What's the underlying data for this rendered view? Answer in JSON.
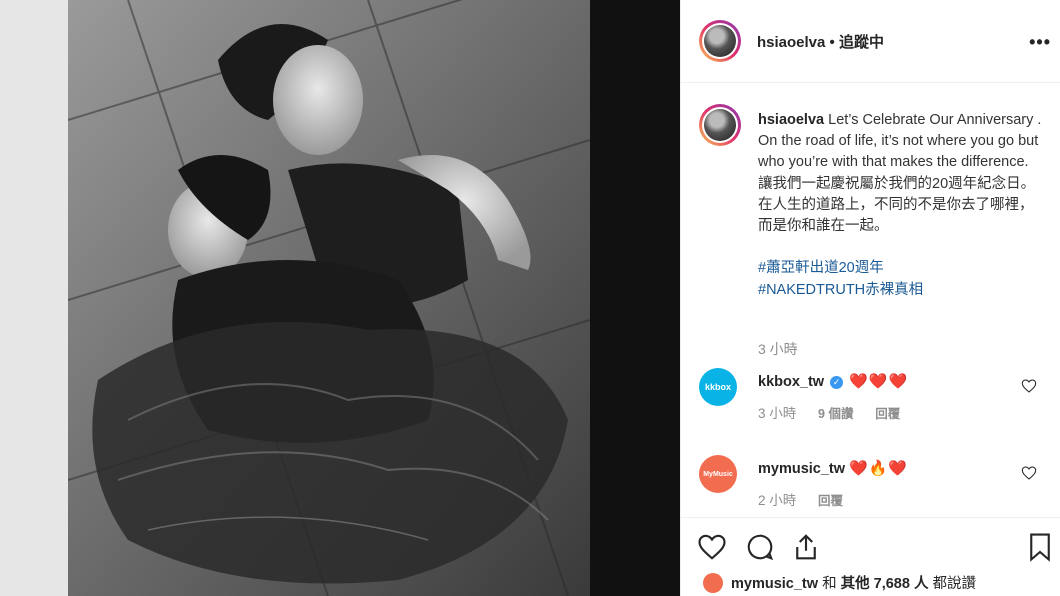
{
  "header": {
    "username": "hsiaoelva",
    "separator": " • ",
    "follow_status": "追蹤中",
    "more_icon": "more-horizontal-icon"
  },
  "caption": {
    "username": "hsiaoelva",
    "text_en": "Let’s Celebrate Our Anniversary . On the road of life, it’s not where you go but who you’re with that makes the difference.",
    "text_zh": "讓我們一起慶祝屬於我們的20週年紀念日。在人生的道路上，不同的不是你去了哪裡，而是你和誰在一起。",
    "hashtags": [
      "#蕭亞軒出道20週年",
      "#NAKEDTRUTH赤裸真相"
    ],
    "time": "3 小時"
  },
  "comments": [
    {
      "username": "kkbox_tw",
      "logo_text": "kkbox",
      "logo_color": "#09b3e6",
      "verified": true,
      "text": "❤️❤️❤️",
      "time": "3 小時",
      "likes": "9 個讚",
      "reply": "回覆"
    },
    {
      "username": "mymusic_tw",
      "logo_text": "MyMusic",
      "logo_color": "#f26c4f",
      "verified": false,
      "text": "❤️🔥❤️",
      "time": "2 小時",
      "reply": "回覆"
    }
  ],
  "actions": {
    "like_icon": "heart-outline-icon",
    "comment_icon": "comment-icon",
    "share_icon": "share-icon",
    "save_icon": "bookmark-icon"
  },
  "liked_by": {
    "user": "mymusic_tw",
    "conj": " 和 ",
    "others": "其他 7,688 人",
    "suffix": " 都說讚"
  },
  "colors": {
    "accent_link": "#1a5a96",
    "verified_blue": "#3897f0",
    "secondary_text": "#8e8e8e",
    "heart_red": "#ed4956"
  }
}
